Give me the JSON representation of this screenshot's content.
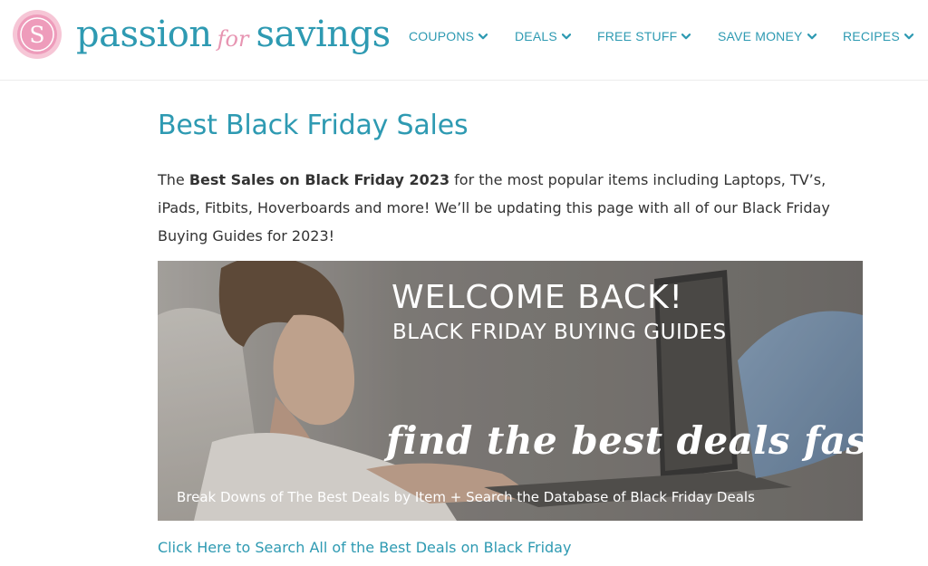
{
  "site": {
    "logo_letter": "S",
    "logo_word1": "passion",
    "logo_for": "for",
    "logo_word2": "savings"
  },
  "nav": {
    "items": [
      {
        "label": "COUPONS"
      },
      {
        "label": "DEALS"
      },
      {
        "label": "FREE STUFF"
      },
      {
        "label": "SAVE MONEY"
      },
      {
        "label": "RECIPES"
      }
    ]
  },
  "article": {
    "title": "Best Black Friday Sales",
    "intro_prefix": "The ",
    "intro_bold": "Best Sales on Black Friday 2023",
    "intro_rest": " for the most popular items including Laptops, TV’s, iPads, Fitbits, Hoverboards and more! We’ll be updating this page with all of our Black Friday Buying Guides for 2023!",
    "cta_link": "Click Here to Search All of the Best Deals on Black Friday"
  },
  "banner": {
    "headline": "WELCOME BACK!",
    "subheadline": "BLACK FRIDAY BUYING GUIDES",
    "script_text": "find the best deals fast!",
    "caption": "Break  Downs of The Best Deals by Item + Search the Database of Black Friday Deals"
  },
  "colors": {
    "brand_teal": "#2e9ab2",
    "brand_pink": "#e795b2",
    "body_text": "#333333"
  }
}
